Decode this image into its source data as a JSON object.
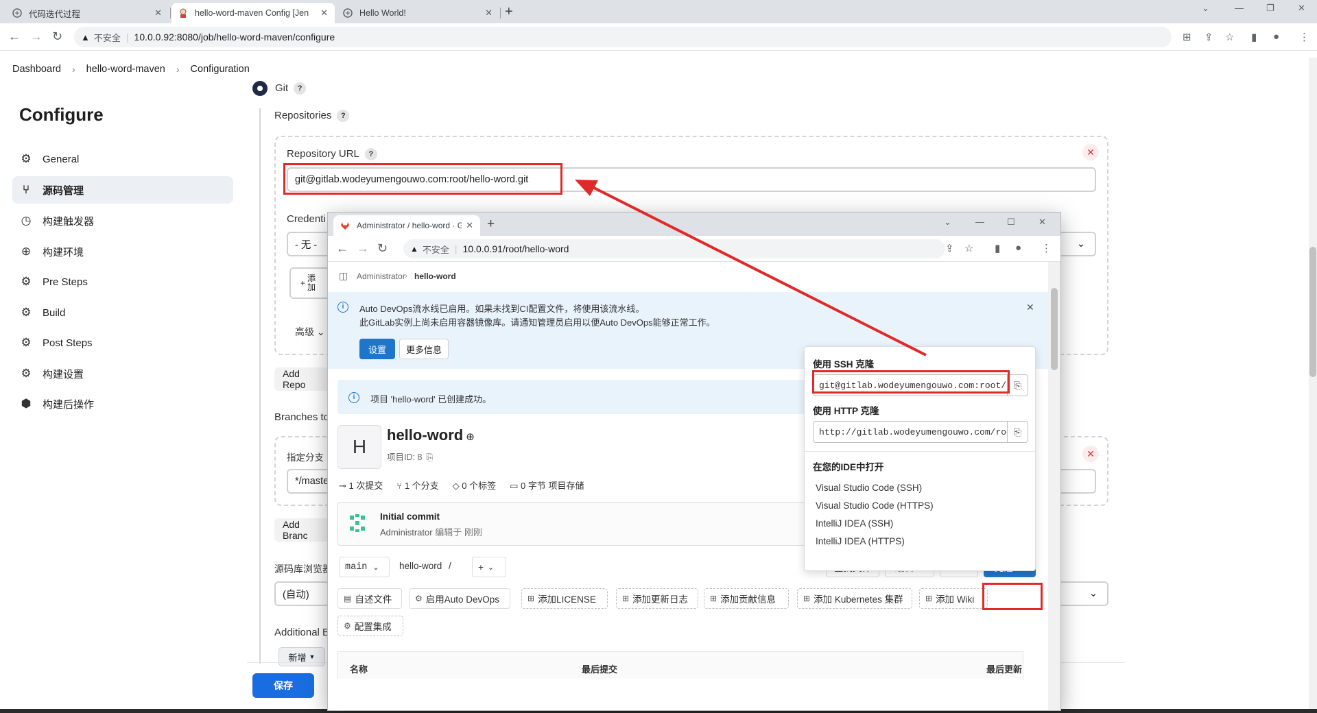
{
  "browser": {
    "tabs": [
      {
        "title": "代码迭代过程",
        "icon": "web-icon",
        "active": false
      },
      {
        "title": "hello-word-maven Config [Jen",
        "icon": "jenkins-icon",
        "active": true
      },
      {
        "title": "Hello World!",
        "icon": "web-icon",
        "active": false
      }
    ],
    "new_tab": "+",
    "security": "不安全",
    "url": "10.0.0.92:8080/job/hello-word-maven/configure"
  },
  "breadcrumb": [
    "Dashboard",
    "hello-word-maven",
    "Configuration"
  ],
  "sidebar": {
    "title": "Configure",
    "items": [
      {
        "label": "General",
        "icon": "gear-icon"
      },
      {
        "label": "源码管理",
        "icon": "branch-icon"
      },
      {
        "label": "构建触发器",
        "icon": "clock-icon"
      },
      {
        "label": "构建环境",
        "icon": "globe-icon"
      },
      {
        "label": "Pre Steps",
        "icon": "gear-icon"
      },
      {
        "label": "Build",
        "icon": "gear-icon"
      },
      {
        "label": "Post Steps",
        "icon": "gear-icon"
      },
      {
        "label": "构建设置",
        "icon": "gear-icon"
      },
      {
        "label": "构建后操作",
        "icon": "cube-icon"
      }
    ],
    "active_index": 1
  },
  "jenkins": {
    "scm_option": "Git",
    "repositories_label": "Repositories",
    "repo_url_label": "Repository URL",
    "repo_url_value": "git@gitlab.wodeyumengouwo.com:root/hello-word.git",
    "credentials_label": "Credenti",
    "credentials_value": "- 无 -",
    "add_button": "添\n加",
    "advanced_label": "高级",
    "add_repo_button": "Add Repo",
    "branches_label": "Branches to",
    "branch_spec_label": "指定分支",
    "branch_spec_value": "*/maste",
    "add_branch_button": "Add Branc",
    "repo_browser_label": "源码库浏览器",
    "repo_browser_value": "(自动)",
    "additional_label": "Additional B",
    "new_button": "新增",
    "save_button": "保存"
  },
  "popup": {
    "tab_title": "Administrator / hello-word · G",
    "security": "不安全",
    "url": "10.0.0.91/root/hello-word",
    "breadcrumb": [
      "Administrator",
      "hello-word"
    ],
    "alert": {
      "line1": "Auto DevOps流水线已启用。如果未找到CI配置文件，将使用该流水线。",
      "line2": "此GitLab实例上尚未启用容器镜像库。请通知管理员启用以便Auto DevOps能够正常工作。",
      "settings_button": "设置",
      "more_button": "更多信息"
    },
    "notice": "项目 'hello-word' 已创建成功。",
    "project": {
      "avatar_letter": "H",
      "name": "hello-word",
      "id_label": "项目ID: 8",
      "stats": [
        "1 次提交",
        "1 个分支",
        "0 个标签",
        "0 字节 项目存储"
      ]
    },
    "commit": {
      "title": "Initial commit",
      "author": "Administrator",
      "meta": "编辑于 刚刚"
    },
    "toolbar": {
      "branch": "main",
      "path": "hello-word",
      "path_sep": "/",
      "find_file": "查找文件",
      "edit": "编辑",
      "clone": "克隆"
    },
    "quick_actions": [
      "自述文件",
      "启用Auto DevOps",
      "添加LICENSE",
      "添加更新日志",
      "添加贡献信息",
      "添加 Kubernetes 集群",
      "添加 Wiki",
      "配置集成"
    ],
    "table_headers": [
      "名称",
      "最后提交",
      "最后更新"
    ],
    "clone_dropdown": {
      "ssh_label": "使用 SSH 克隆",
      "ssh_url": "git@gitlab.wodeyumengouwo.com:root/hello-word.git",
      "http_label": "使用 HTTP 克隆",
      "http_url": "http://gitlab.wodeyumengouwo.com/root/hello-word.git",
      "ide_label": "在您的IDE中打开",
      "ide_items": [
        "Visual Studio Code (SSH)",
        "Visual Studio Code (HTTPS)",
        "IntelliJ IDEA (SSH)",
        "IntelliJ IDEA (HTTPS)"
      ]
    }
  },
  "colors": {
    "annotation_red": "#e02a2a",
    "jenkins_blue": "#1a6de0",
    "gitlab_blue": "#1f75cb",
    "alert_bg": "#e9f3fc"
  }
}
